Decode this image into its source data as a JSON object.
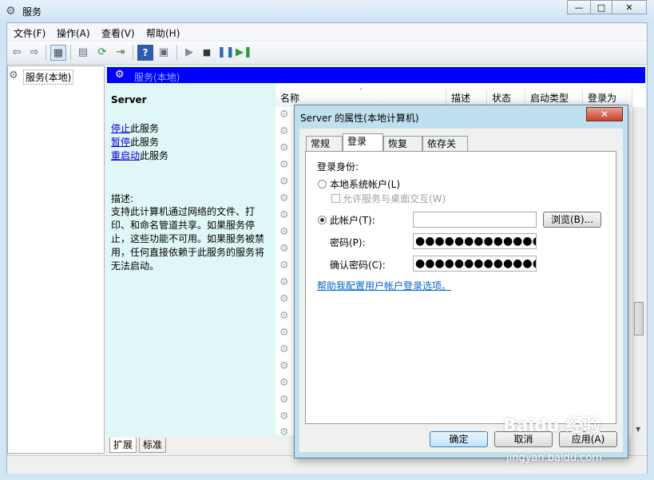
{
  "window": {
    "title": "服务",
    "minimize": "—",
    "maximize": "□",
    "close": "✕"
  },
  "menu": [
    "文件(F)",
    "操作(A)",
    "查看(V)",
    "帮助(H)"
  ],
  "tree": {
    "root": "服务(本地)"
  },
  "header": {
    "title": "服务(本地)"
  },
  "details": {
    "service_name": "Server",
    "actions": [
      {
        "link": "停止",
        "suffix": "此服务"
      },
      {
        "link": "暂停",
        "suffix": "此服务"
      },
      {
        "link": "重启动",
        "suffix": "此服务"
      }
    ],
    "desc_label": "描述:",
    "desc_text": "支持此计算机通过网络的文件、打印、和命名管道共享。如果服务停止，这些功能不可用。如果服务被禁用，任何直接依赖于此服务的服务将无法启动。"
  },
  "list": {
    "columns": [
      "名称",
      "描述",
      "状态",
      "启动类型",
      "登录为"
    ]
  },
  "bottom_tabs": [
    "扩展",
    "标准"
  ],
  "dialog": {
    "title": "Server 的属性(本地计算机)",
    "tabs": [
      "常规",
      "登录",
      "恢复",
      "依存关系"
    ],
    "active_tab": "登录",
    "logon_as": "登录身份:",
    "local_system": "本地系统帐户(L)",
    "allow_desktop": "允许服务与桌面交互(W)",
    "this_account": "此帐户(T):",
    "account_value": "",
    "browse": "浏览(B)...",
    "password_label": "密码(P):",
    "password_value": "●●●●●●●●●●●●●●●●",
    "confirm_label": "确认密码(C):",
    "confirm_value": "●●●●●●●●●●●●●●●●",
    "help_link": "帮助我配置用户帐户登录选项。",
    "ok": "确定",
    "cancel": "取消",
    "apply": "应用(A)"
  },
  "watermark": {
    "brand": "Baidu 经验",
    "url": "jingyan.baidu.com"
  }
}
